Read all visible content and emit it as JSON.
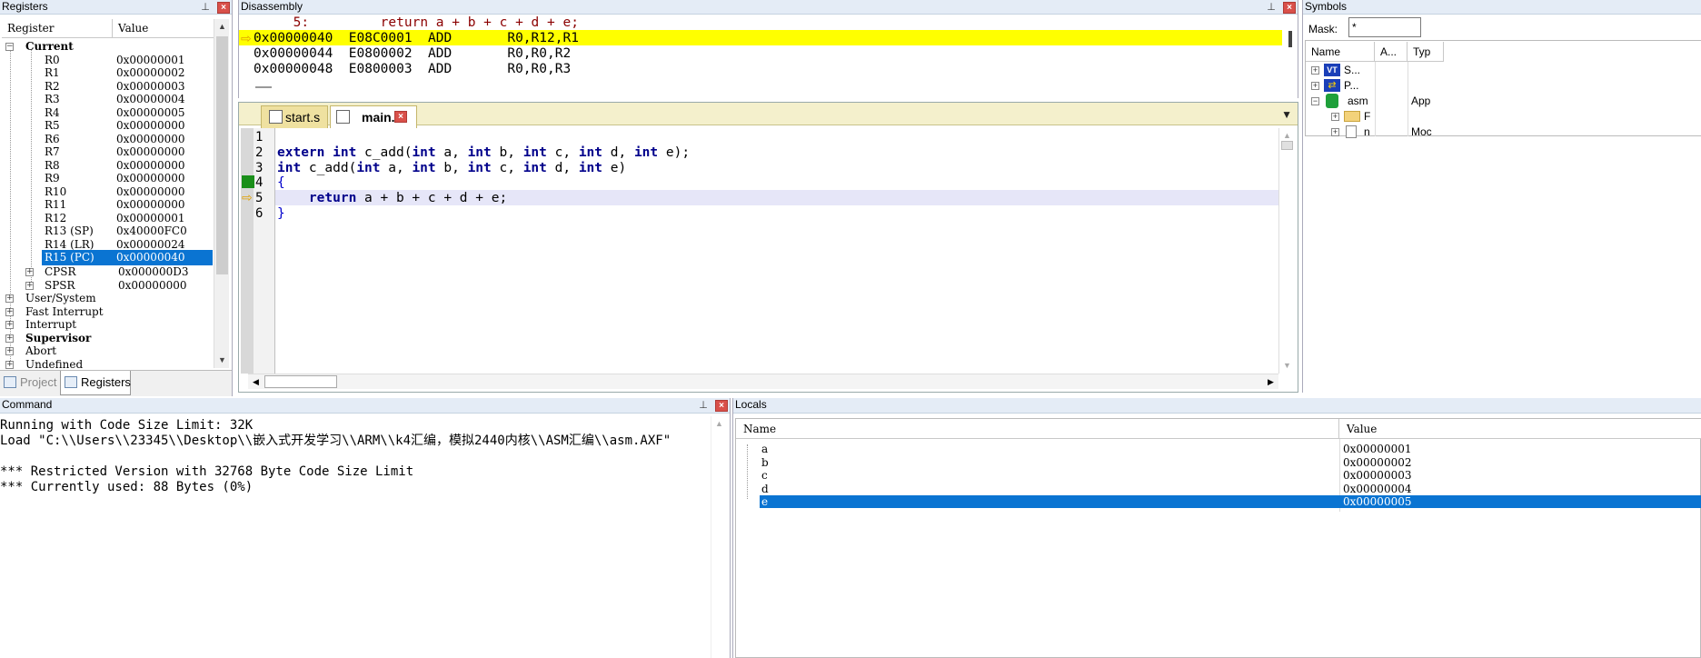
{
  "registers": {
    "title": "Registers",
    "col_register": "Register",
    "col_value": "Value",
    "current_label": "Current",
    "rows": [
      {
        "name": "R0",
        "value": "0x00000001"
      },
      {
        "name": "R1",
        "value": "0x00000002"
      },
      {
        "name": "R2",
        "value": "0x00000003"
      },
      {
        "name": "R3",
        "value": "0x00000004"
      },
      {
        "name": "R4",
        "value": "0x00000005"
      },
      {
        "name": "R5",
        "value": "0x00000000"
      },
      {
        "name": "R6",
        "value": "0x00000000"
      },
      {
        "name": "R7",
        "value": "0x00000000"
      },
      {
        "name": "R8",
        "value": "0x00000000"
      },
      {
        "name": "R9",
        "value": "0x00000000"
      },
      {
        "name": "R10",
        "value": "0x00000000"
      },
      {
        "name": "R11",
        "value": "0x00000000"
      },
      {
        "name": "R12",
        "value": "0x00000001"
      },
      {
        "name": "R13 (SP)",
        "value": "0x40000FC0"
      },
      {
        "name": "R14 (LR)",
        "value": "0x00000024"
      },
      {
        "name": "R15 (PC)",
        "value": "0x00000040"
      }
    ],
    "cpsr_name": "CPSR",
    "cpsr_value": "0x000000D3",
    "spsr_name": "SPSR",
    "spsr_value": "0x00000000",
    "modes": [
      "User/System",
      "Fast Interrupt",
      "Interrupt",
      "Supervisor",
      "Abort",
      "Undefined"
    ],
    "tab_project": "Project",
    "tab_registers": "Registers"
  },
  "disassembly": {
    "title": "Disassembly",
    "source_line": "     5:         return a + b + c + d + e;",
    "lines": [
      "0x00000040  E08C0001  ADD       R0,R12,R1",
      "0x00000044  E0800002  ADD       R0,R0,R2",
      "0x00000048  E0800003  ADD       R0,R0,R3"
    ]
  },
  "editor": {
    "tabs": [
      "start.s",
      "main.c"
    ],
    "line_numbers": [
      "1",
      "2",
      "3",
      "4",
      "5",
      "6"
    ],
    "code": [
      "",
      "extern int c_add(int a, int b, int c, int d, int e);",
      "int c_add(int a, int b, int c, int d, int e)",
      "{",
      "    return a + b + c + d + e;",
      "}"
    ]
  },
  "symbols": {
    "title": "Symbols",
    "mask_label": "Mask:",
    "mask_value": "*",
    "col_name": "Name",
    "col_a": "A...",
    "col_type": "Typ",
    "rows": [
      {
        "label": "S...",
        "extra": ""
      },
      {
        "label": "P...",
        "extra": ""
      },
      {
        "label": "asm",
        "extra": "App"
      },
      {
        "label": "F",
        "extra": ""
      },
      {
        "label": "n",
        "extra": "Moc"
      }
    ]
  },
  "command": {
    "title": "Command",
    "lines": [
      "Running with Code Size Limit: 32K",
      "Load \"C:\\\\Users\\\\23345\\\\Desktop\\\\嵌入式开发学习\\\\ARM\\\\k4汇编，模拟2440内核\\\\ASM汇编\\\\asm.AXF\"",
      "",
      "*** Restricted Version with 32768 Byte Code Size Limit",
      "*** Currently used: 88 Bytes (0%)"
    ]
  },
  "locals": {
    "title": "Locals",
    "col_name": "Name",
    "col_value": "Value",
    "rows": [
      {
        "name": "a",
        "value": "0x00000001"
      },
      {
        "name": "b",
        "value": "0x00000002"
      },
      {
        "name": "c",
        "value": "0x00000003"
      },
      {
        "name": "d",
        "value": "0x00000004"
      },
      {
        "name": "e",
        "value": "0x00000005"
      }
    ]
  },
  "colors": {
    "highlight_yellow": "#ffff00",
    "selection_blue": "#0a74d2",
    "keyword_blue": "#00008b",
    "breakpoint_green": "#1a8f1a"
  }
}
